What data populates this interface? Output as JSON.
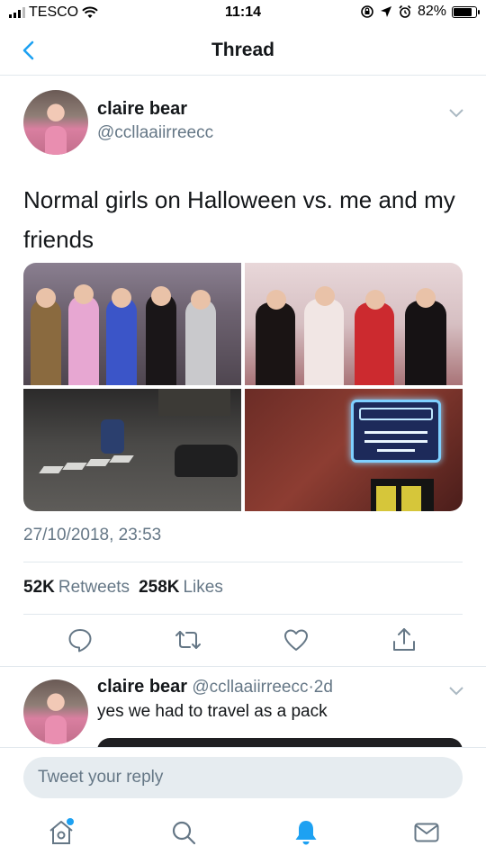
{
  "status_bar": {
    "carrier": "TESCO",
    "time": "11:14",
    "battery": "82%",
    "battery_level": 0.82
  },
  "nav": {
    "title": "Thread",
    "back_icon": "chevron-left-icon"
  },
  "tweet": {
    "author_name": "claire bear",
    "author_handle": "@ccllaaiirreecc",
    "text": "Normal girls on Halloween vs. me and my friends",
    "media": [
      {
        "caption": "",
        "sign_text": ""
      },
      {
        "caption": ""
      },
      {
        "caption": ""
      },
      {
        "sign_brand": "BUD LIGHT",
        "sign_text": "WELCOME TO SKYBAR KARAOKE EVERY TUES & THUR"
      }
    ],
    "timestamp": "27/10/2018, 23:53",
    "retweets_count": "52K",
    "retweets_label": "Retweets",
    "likes_count": "258K",
    "likes_label": "Likes",
    "actions": [
      "reply-icon",
      "retweet-icon",
      "like-icon",
      "share-icon"
    ]
  },
  "reply": {
    "author_name": "claire bear",
    "author_handle": "@ccllaaiirreecc",
    "separator": "·",
    "age": "2d",
    "text": "yes we had to travel as a pack"
  },
  "compose": {
    "placeholder": "Tweet your reply"
  },
  "tabbar": {
    "items": [
      "home-icon",
      "search-icon",
      "notifications-icon",
      "messages-icon"
    ],
    "active": "notifications-icon"
  },
  "colors": {
    "accent": "#1da1f2",
    "secondary_text": "#657786",
    "divider": "#e1e8ed"
  }
}
